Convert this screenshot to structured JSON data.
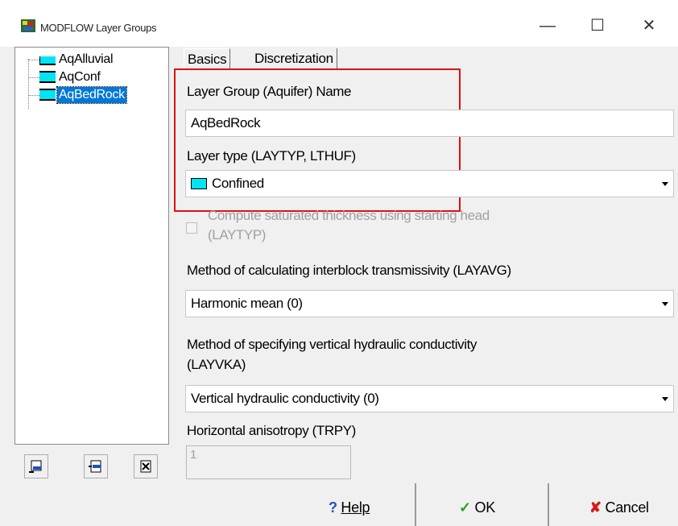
{
  "window": {
    "title": "MODFLOW Layer Groups",
    "minimize_glyph": "—",
    "maximize_glyph": "☐",
    "close_glyph": "✕"
  },
  "tree": {
    "items": [
      {
        "label": "AqAlluvial",
        "icon": "layer-unconfined-icon",
        "selected": false
      },
      {
        "label": "AqConf",
        "icon": "layer-confined-icon",
        "selected": false
      },
      {
        "label": "AqBedRock",
        "icon": "layer-confined-icon",
        "selected": true
      }
    ]
  },
  "tabs": [
    {
      "label": "Basics",
      "active": true
    },
    {
      "label": "Discretization",
      "active": false
    }
  ],
  "form": {
    "name_label": "Layer Group (Aquifer) Name",
    "name_value": "AqBedRock",
    "layer_type_label": "Layer type (LAYTYP, LTHUF)",
    "layer_type_value": "Confined",
    "saturated_line1": "Compute saturated thickness using starting head",
    "saturated_line2": "(LAYTYP)",
    "interblock_label": "Method of calculating interblock transmissivity (LAYAVG)",
    "interblock_value": "Harmonic mean (0)",
    "vk_label_line1": "Method of specifying vertical hydraulic conductivity",
    "vk_label_line2": "(LAYVKA)",
    "vk_value": "Vertical hydraulic conductivity (0)",
    "anisotropy_label": "Horizontal anisotropy (TRPY)",
    "anisotropy_value": "1"
  },
  "buttons": {
    "help": "Help",
    "ok": "OK",
    "cancel": "Cancel"
  },
  "colors": {
    "selection": "#0078d7",
    "layer_cyan": "#00e5f0",
    "highlight_red": "#e01010"
  }
}
